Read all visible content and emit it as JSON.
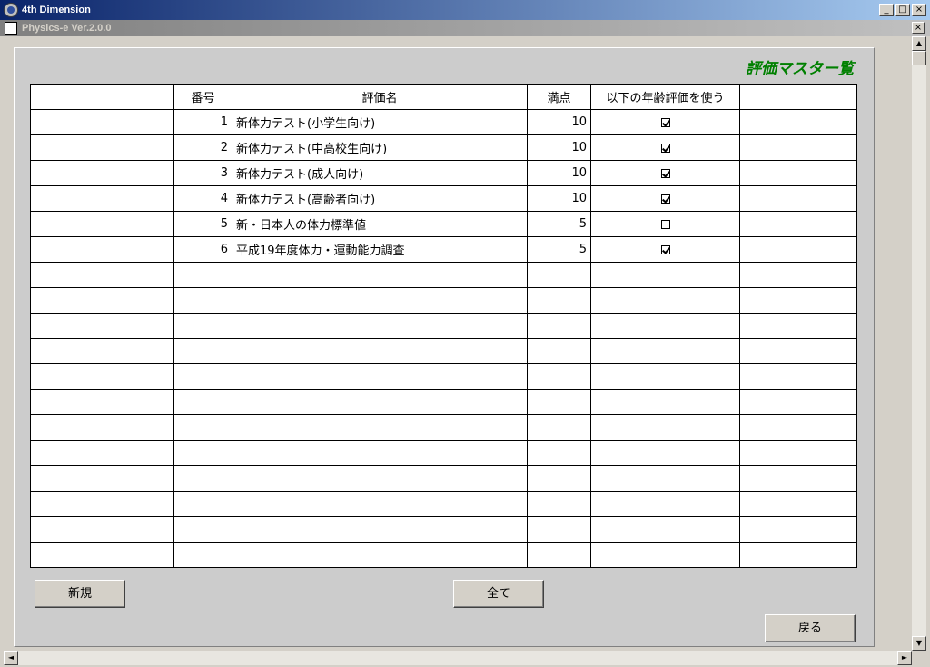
{
  "window": {
    "app_title": "4th Dimension",
    "doc_title": "Physics-e  Ver.2.0.0",
    "minimize": "_",
    "maximize": "□",
    "close": "×"
  },
  "panel_title": "評価マスター覧",
  "table": {
    "columns": [
      "",
      "番号",
      "評価名",
      "満点",
      "以下の年齢評価を使う",
      ""
    ],
    "rows": [
      {
        "no": "1",
        "name": "新体力テスト(小学生向け)",
        "max": "10",
        "use_age": true
      },
      {
        "no": "2",
        "name": "新体力テスト(中高校生向け)",
        "max": "10",
        "use_age": true
      },
      {
        "no": "3",
        "name": "新体力テスト(成人向け)",
        "max": "10",
        "use_age": true
      },
      {
        "no": "4",
        "name": "新体力テスト(高齢者向け)",
        "max": "10",
        "use_age": true
      },
      {
        "no": "5",
        "name": "新・日本人の体力標準値",
        "max": "5",
        "use_age": false
      },
      {
        "no": "6",
        "name": "平成19年度体力・運動能力調査",
        "max": "5",
        "use_age": true
      }
    ],
    "empty_rows": 12
  },
  "buttons": {
    "new": "新規",
    "all": "全て",
    "back": "戻る"
  },
  "icons": {
    "scroll_up": "▲",
    "scroll_down": "▼",
    "scroll_left": "◄",
    "scroll_right": "►"
  },
  "colors": {
    "title_green": "#008000",
    "panel_bg": "#cccccc",
    "titlebar_blue": "#0a246a"
  }
}
